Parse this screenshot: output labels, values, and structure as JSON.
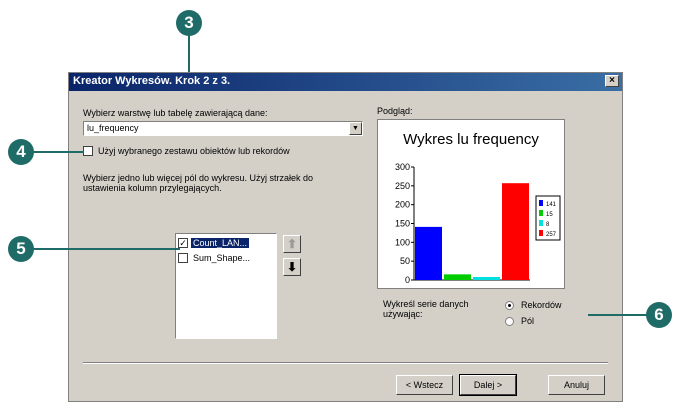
{
  "dialog": {
    "title": "Kreator Wykresów. Krok 2 z 3.",
    "close_label": "×"
  },
  "layer_section": {
    "label": "Wybierz warstwę lub tabelę zawierającą dane:",
    "selected_layer": "lu_frequency",
    "use_selected_label": "Użyj wybranego zestawu obiektów lub rekordów",
    "use_selected_checked": false
  },
  "fields_section": {
    "instructions_line1": "Wybierz jedno lub więcej pól do wykresu. Użyj strzałek do",
    "instructions_line2": "ustawienia kolumn przylegających.",
    "items": [
      {
        "label": "Count_LAN...",
        "checked": true,
        "selected": true
      },
      {
        "label": "Sum_Shape...",
        "checked": false,
        "selected": false
      }
    ],
    "up_icon": "arrow-up-icon",
    "down_icon": "arrow-down-icon"
  },
  "preview": {
    "label": "Podgląd:",
    "chart_data": {
      "type": "bar",
      "title": "Wykres lu frequency",
      "categories": [
        "141",
        "15",
        "8",
        "257"
      ],
      "values": [
        141,
        15,
        8,
        257
      ],
      "colors": [
        "#0000ff",
        "#00cc00",
        "#00e0e0",
        "#ff0000"
      ],
      "ylim": [
        0,
        300
      ],
      "yticks": [
        "0",
        "50",
        "100",
        "150",
        "200",
        "250",
        "300"
      ],
      "legend": [
        "141",
        "15",
        "8",
        "257"
      ],
      "legend_position": "right"
    }
  },
  "series_section": {
    "label_line1": "Wykreśl serie danych",
    "label_line2": "używając:",
    "option_records": "Rekordów",
    "option_fields": "Pól",
    "selected": "records"
  },
  "buttons": {
    "back": "< Wstecz",
    "next": "Dalej >",
    "cancel": "Anuluj"
  },
  "callouts": [
    "3",
    "4",
    "5",
    "6"
  ],
  "colors": {
    "callout": "#1f6b67",
    "titlebar": "#0a246a",
    "dialog_bg": "#d4d0c8"
  }
}
